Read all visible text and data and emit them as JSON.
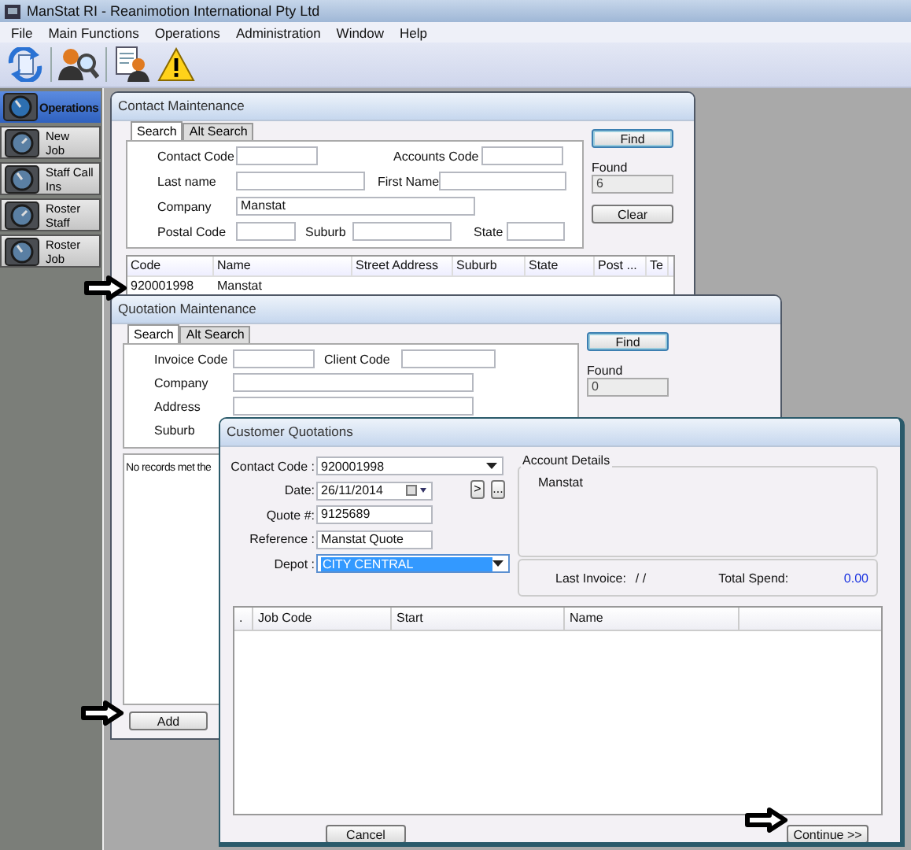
{
  "app": {
    "title": "ManStat RI - Reanimotion International Pty Ltd"
  },
  "menu": [
    "File",
    "Main Functions",
    "Operations",
    "Administration",
    "Window",
    "Help"
  ],
  "sidebar": {
    "header": "Operations",
    "items": [
      {
        "lines": [
          "New",
          "Job"
        ]
      },
      {
        "lines": [
          "Staff Call",
          "Ins"
        ]
      },
      {
        "lines": [
          "Roster",
          "Staff"
        ]
      },
      {
        "lines": [
          "Roster",
          "Job"
        ]
      }
    ]
  },
  "contact_maintenance": {
    "title": "Contact Maintenance",
    "tabs": [
      {
        "label": "Search",
        "selected": true
      },
      {
        "label": "Alt Search",
        "selected": false
      }
    ],
    "search_fields": [
      [
        {
          "label": "Contact Code"
        },
        {
          "label": "Accounts Code"
        }
      ],
      [
        {
          "label": "Last name"
        },
        {
          "label": "First Name"
        }
      ],
      [
        {
          "label": "Company",
          "value": "Manstat"
        }
      ],
      [
        {
          "label": "Postal Code"
        },
        {
          "label": "Suburb"
        },
        {
          "label": "State"
        }
      ]
    ],
    "find": "Find",
    "found_label": "Found",
    "found": {
      "value": "6",
      "disabled": true
    },
    "clear": "Clear",
    "columns": [
      "Code",
      "Name",
      "Street Address",
      "Suburb",
      "State",
      "Post ...",
      "Te"
    ],
    "rows": [
      [
        "920001998",
        "Manstat"
      ]
    ]
  },
  "quotation_maintenance": {
    "title": "Quotation Maintenance",
    "tabs": [
      {
        "label": "Search",
        "selected": true
      },
      {
        "label": "Alt Search",
        "selected": false
      }
    ],
    "search_fields": [
      [
        {
          "label": "Invoice Code"
        },
        {
          "label": "Client Code"
        }
      ],
      [
        {
          "label": "Company"
        }
      ],
      [
        {
          "label": "Address"
        }
      ],
      [
        {
          "label": "Suburb",
          "field_covered": true
        }
      ]
    ],
    "find": "Find",
    "found_label": "Found",
    "found": {
      "value": "0",
      "disabled": true
    },
    "message": "No records met the",
    "add": "Add"
  },
  "customer_quotations": {
    "title": "Customer Quotations",
    "fields": [
      {
        "label": "Contact Code :",
        "value": "920001998",
        "kind": "combo",
        "highlighted": false
      },
      {
        "label": "Date:",
        "value": "26/11/2014",
        "kind": "date",
        "highlighted": false
      },
      {
        "label": "Quote #:",
        "value": "9125689",
        "kind": "text",
        "highlighted": false
      },
      {
        "label": "Reference :",
        "value": "Manstat Quote",
        "kind": "text",
        "highlighted": false
      },
      {
        "label": "Depot :",
        "value": "CITY CENTRAL",
        "kind": "combo",
        "highlighted": true
      }
    ],
    "nav_buttons": [
      ">",
      "..."
    ],
    "account": {
      "legend": "Account Details",
      "name": "Manstat",
      "last_invoice_label": "Last Invoice:",
      "last_invoice": "/ /",
      "total_spend_label": "Total Spend:",
      "total_spend": "0.00"
    },
    "columns": [
      ".",
      "Job Code",
      "Start",
      "Name"
    ],
    "cancel": "Cancel",
    "continue": "Continue >>"
  }
}
